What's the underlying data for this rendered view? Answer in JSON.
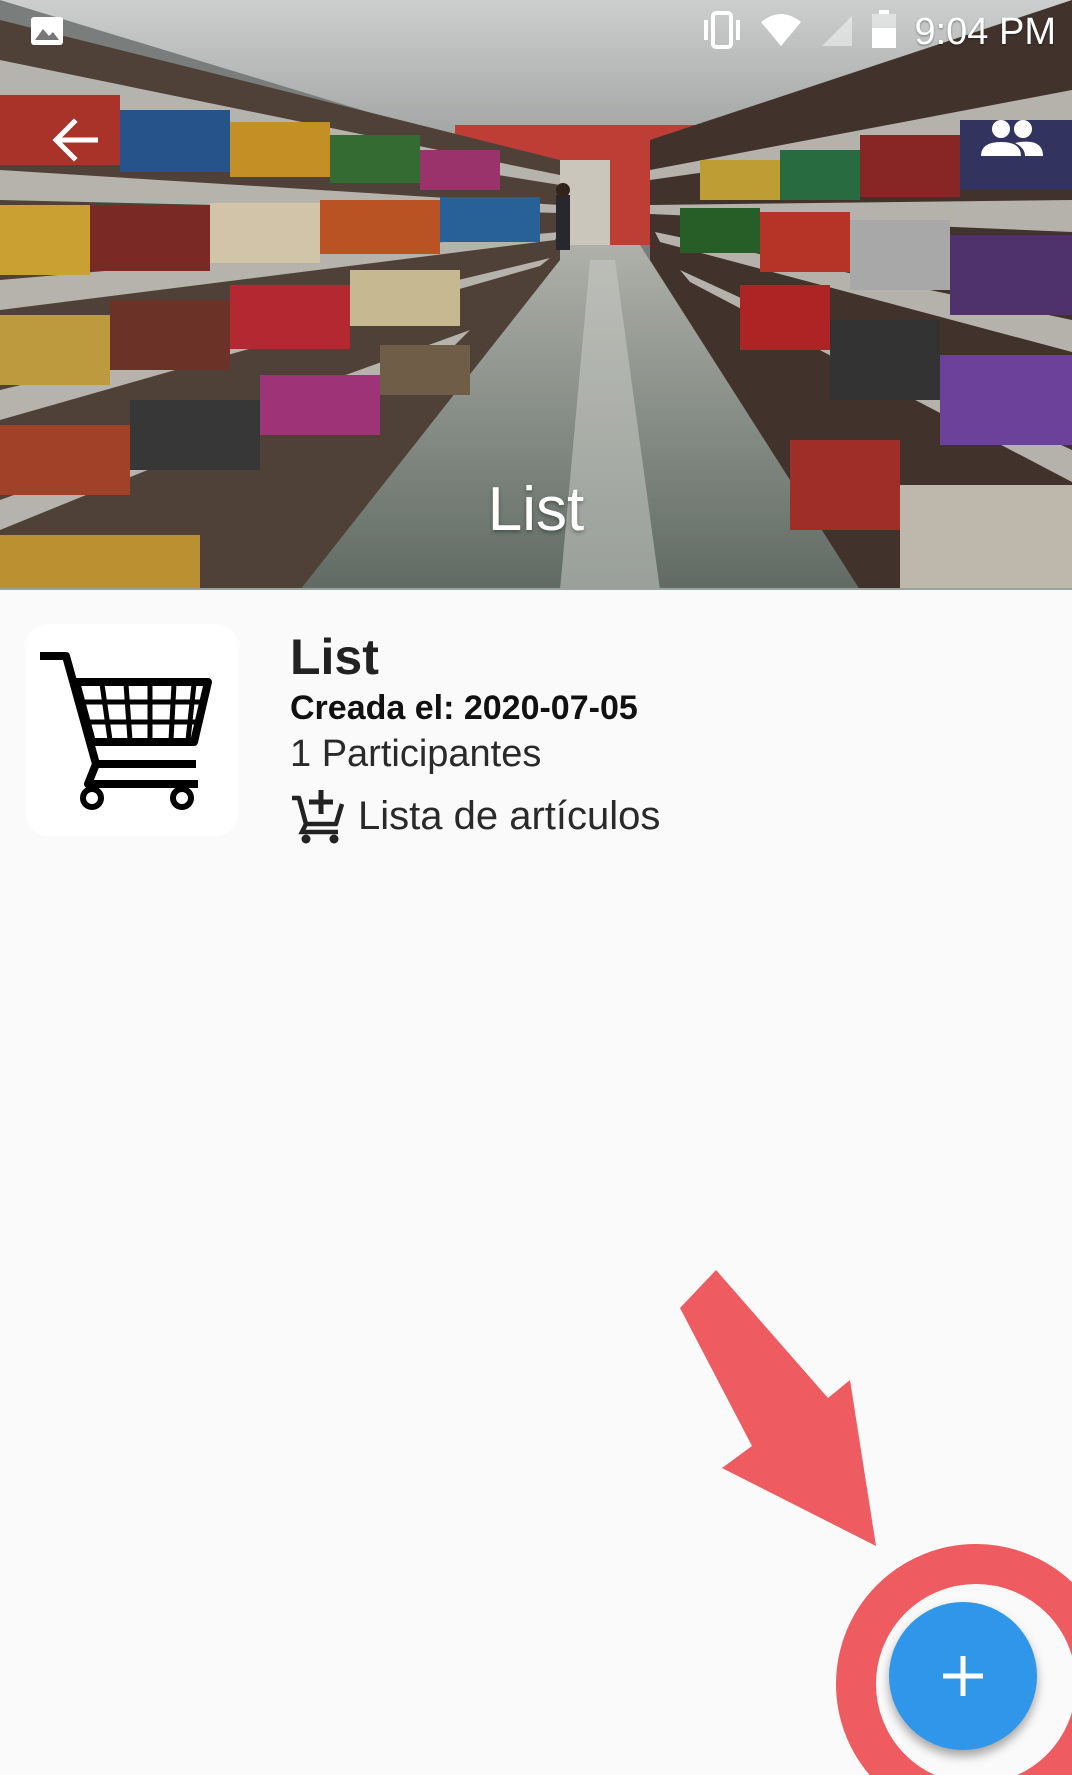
{
  "status_bar": {
    "time": "9:04 PM",
    "icons": [
      "image-icon",
      "vibrate-icon",
      "wifi-icon",
      "no-sim-icon",
      "battery-icon"
    ]
  },
  "header": {
    "title": "List",
    "back_icon": "arrow-back-icon",
    "people_icon": "group-icon"
  },
  "list": {
    "name": "List",
    "created": "Creada el: 2020-07-05",
    "participants": "1 Participantes",
    "items_label": "Lista de artículos",
    "items_icon": "add-shopping-cart-icon",
    "thumbnail_icon": "shopping-cart-icon"
  },
  "fab": {
    "icon": "plus-icon",
    "color": "#2f96ea"
  },
  "annotation": {
    "color": "#ee5b60"
  }
}
